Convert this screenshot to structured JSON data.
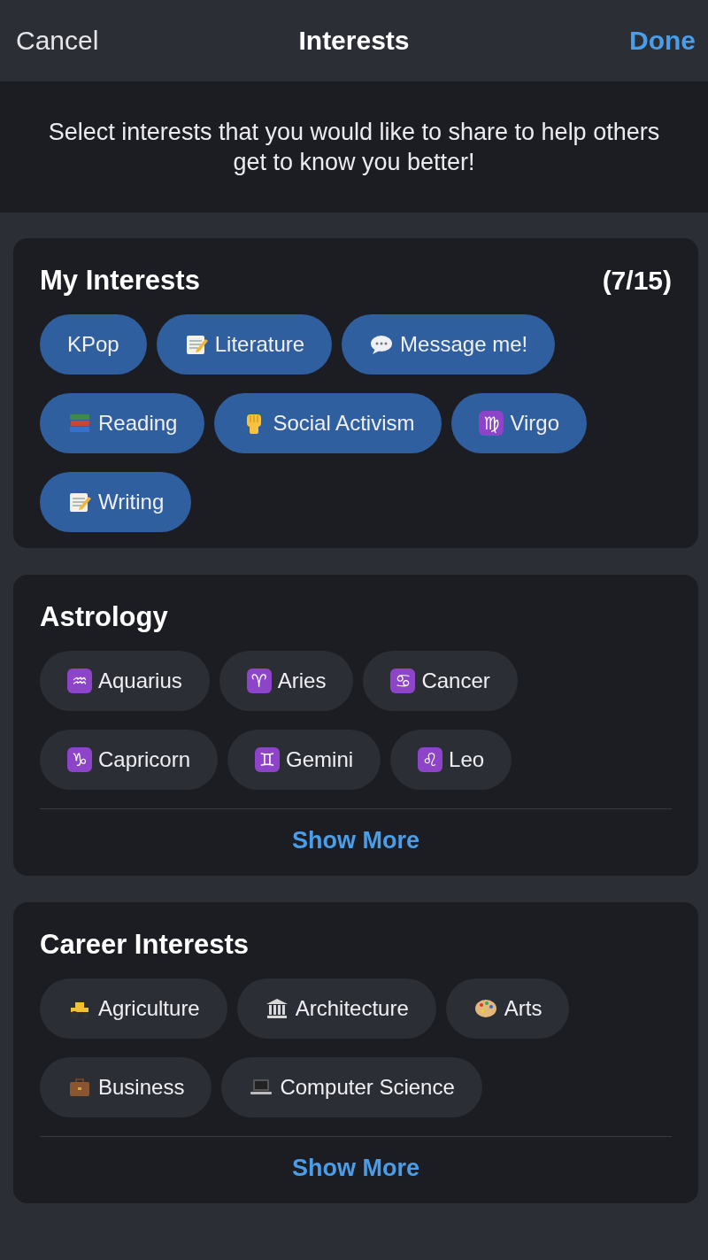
{
  "nav": {
    "cancel": "Cancel",
    "title": "Interests",
    "done": "Done"
  },
  "intro": "Select interests that you would like to share to help others get to know you better!",
  "sections": [
    {
      "title": "My Interests",
      "count": "(7/15)",
      "chips": [
        {
          "label": "KPop",
          "kind": "plain",
          "selected": true
        },
        {
          "label": "Literature",
          "kind": "memo",
          "selected": true
        },
        {
          "label": "Message me!",
          "kind": "speech",
          "selected": true
        },
        {
          "label": "Reading",
          "kind": "books",
          "selected": true
        },
        {
          "label": "Social Activism",
          "kind": "fist",
          "selected": true
        },
        {
          "label": "Virgo",
          "kind": "zodiac",
          "symbol": "♍",
          "selected": true
        },
        {
          "label": "Writing",
          "kind": "memo",
          "selected": true
        }
      ]
    },
    {
      "title": "Astrology",
      "chips": [
        {
          "label": "Aquarius",
          "kind": "zodiac",
          "symbol": "♒",
          "selected": false
        },
        {
          "label": "Aries",
          "kind": "zodiac",
          "symbol": "♈",
          "selected": false
        },
        {
          "label": "Cancer",
          "kind": "zodiac",
          "symbol": "♋",
          "selected": false
        },
        {
          "label": "Capricorn",
          "kind": "zodiac",
          "symbol": "♑",
          "selected": false
        },
        {
          "label": "Gemini",
          "kind": "zodiac",
          "symbol": "♊",
          "selected": false
        },
        {
          "label": "Leo",
          "kind": "zodiac",
          "symbol": "♌",
          "selected": false
        }
      ],
      "more": "Show More"
    },
    {
      "title": "Career Interests",
      "chips": [
        {
          "label": "Agriculture",
          "kind": "tractor",
          "selected": false
        },
        {
          "label": "Architecture",
          "kind": "building",
          "selected": false
        },
        {
          "label": "Arts",
          "kind": "palette",
          "selected": false
        },
        {
          "label": "Business",
          "kind": "briefcase",
          "selected": false
        },
        {
          "label": "Computer Science",
          "kind": "laptop",
          "selected": false
        }
      ],
      "more": "Show More"
    }
  ]
}
